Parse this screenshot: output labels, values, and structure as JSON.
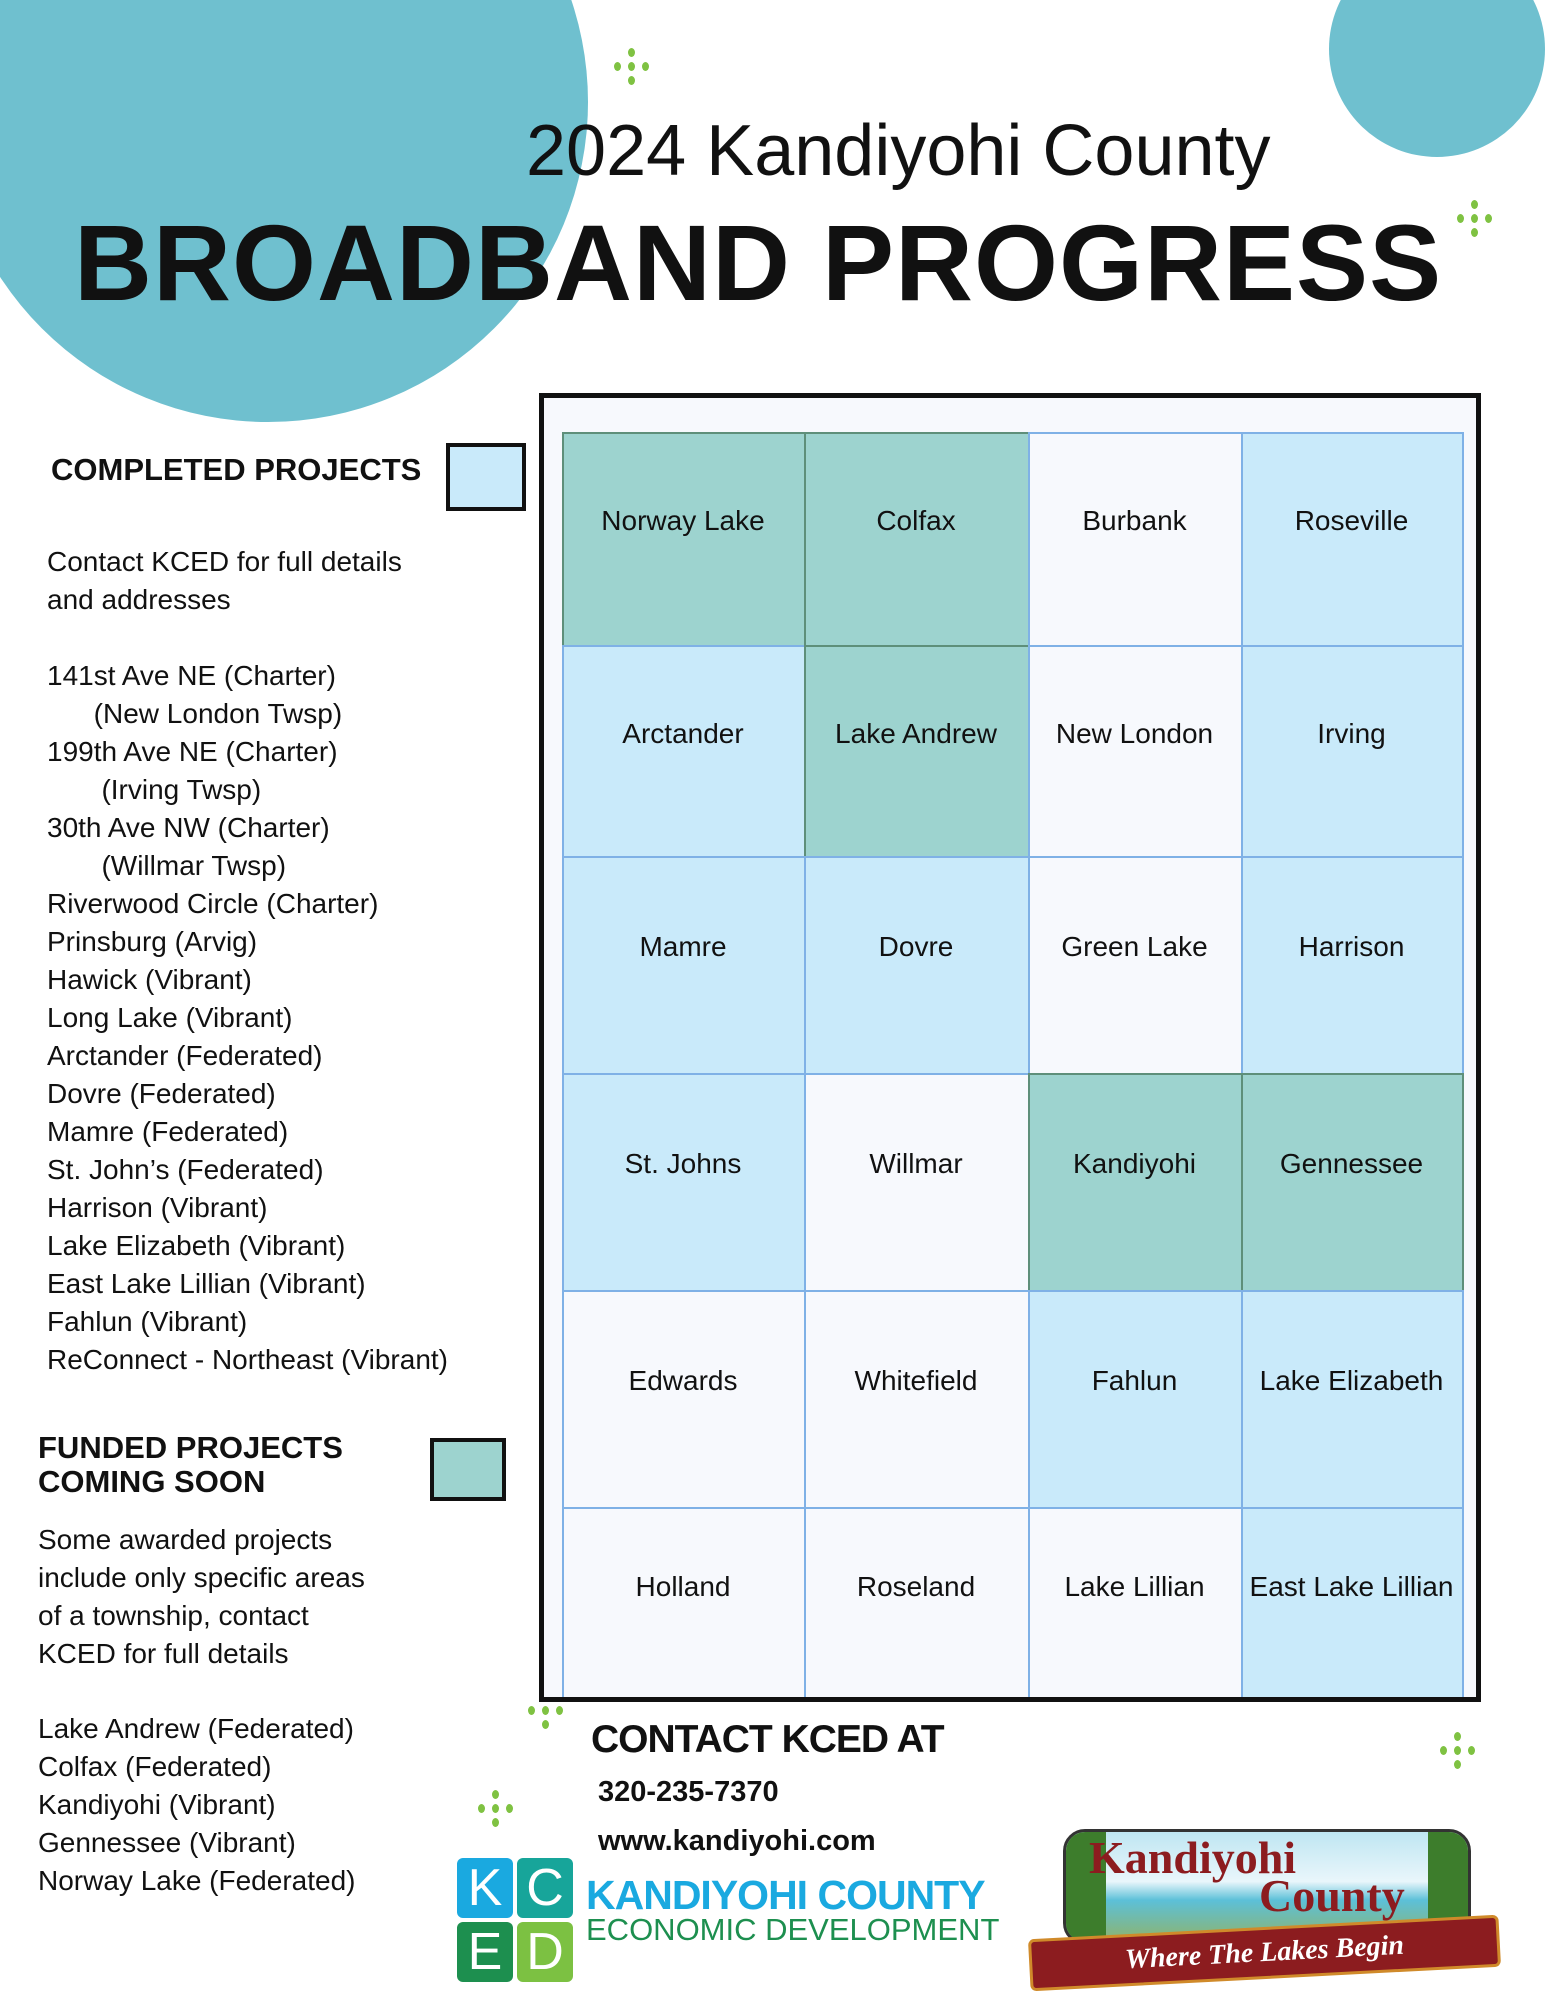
{
  "header": {
    "year_title": "2024 Kandiyohi County",
    "main_title": "BROADBAND PROGRESS"
  },
  "colors": {
    "completed": "#c9eafa",
    "funded": "#9dd3cf",
    "none": "#f7f9fd",
    "accent_circle": "#6fc0cf",
    "dots": "#7fc242"
  },
  "completed": {
    "heading": "COMPLETED PROJECTS",
    "note": "Contact KCED for full details\nand addresses",
    "items": [
      "141st Ave NE (Charter)",
      "      (New London Twsp)",
      "199th Ave NE (Charter)",
      "       (Irving Twsp)",
      "30th Ave NW (Charter)",
      "       (Willmar Twsp)",
      "Riverwood Circle (Charter)",
      "Prinsburg (Arvig)",
      "Hawick (Vibrant)",
      "Long Lake (Vibrant)",
      "Arctander (Federated)",
      "Dovre (Federated)",
      "Mamre (Federated)",
      "St. John’s (Federated)",
      "Harrison (Vibrant)",
      "Lake Elizabeth (Vibrant)",
      "East Lake Lillian (Vibrant)",
      "Fahlun (Vibrant)",
      "ReConnect - Northeast (Vibrant)"
    ]
  },
  "funded": {
    "heading_line1": "FUNDED PROJECTS",
    "heading_line2": "COMING SOON",
    "note": "Some awarded projects\ninclude only specific areas\nof a township, contact\nKCED for full details",
    "items": [
      "Lake Andrew (Federated)",
      "Colfax (Federated)",
      "Kandiyohi (Vibrant)",
      "Gennessee (Vibrant)",
      "Norway Lake (Federated)"
    ]
  },
  "map": {
    "townships": [
      {
        "name": "Norway Lake",
        "status": "funded"
      },
      {
        "name": "Colfax",
        "status": "funded"
      },
      {
        "name": "Burbank",
        "status": "none"
      },
      {
        "name": "Roseville",
        "status": "completed"
      },
      {
        "name": "Arctander",
        "status": "completed"
      },
      {
        "name": "Lake Andrew",
        "status": "funded"
      },
      {
        "name": "New London",
        "status": "none"
      },
      {
        "name": "Irving",
        "status": "completed"
      },
      {
        "name": "Mamre",
        "status": "completed"
      },
      {
        "name": "Dovre",
        "status": "completed"
      },
      {
        "name": "Green Lake",
        "status": "none"
      },
      {
        "name": "Harrison",
        "status": "completed"
      },
      {
        "name": "St. Johns",
        "status": "completed"
      },
      {
        "name": "Willmar",
        "status": "none"
      },
      {
        "name": "Kandiyohi",
        "status": "funded"
      },
      {
        "name": "Gennessee",
        "status": "funded"
      },
      {
        "name": "Edwards",
        "status": "none"
      },
      {
        "name": "Whitefield",
        "status": "none"
      },
      {
        "name": "Fahlun",
        "status": "completed"
      },
      {
        "name": "Lake Elizabeth",
        "status": "completed"
      },
      {
        "name": "Holland",
        "status": "none"
      },
      {
        "name": "Roseland",
        "status": "none"
      },
      {
        "name": "Lake Lillian",
        "status": "none"
      },
      {
        "name": "East Lake Lillian",
        "status": "completed"
      }
    ]
  },
  "contact": {
    "heading": "CONTACT KCED AT",
    "phone": "320-235-7370",
    "website": "www.kandiyohi.com"
  },
  "kced_logo": {
    "letters": [
      "K",
      "C",
      "E",
      "D"
    ],
    "name": "KANDIYOHI COUNTY",
    "subtitle": "ECONOMIC DEVELOPMENT"
  },
  "county_logo": {
    "line1": "Kandiyohi",
    "line2": "County",
    "tagline": "Where The Lakes Begin"
  }
}
